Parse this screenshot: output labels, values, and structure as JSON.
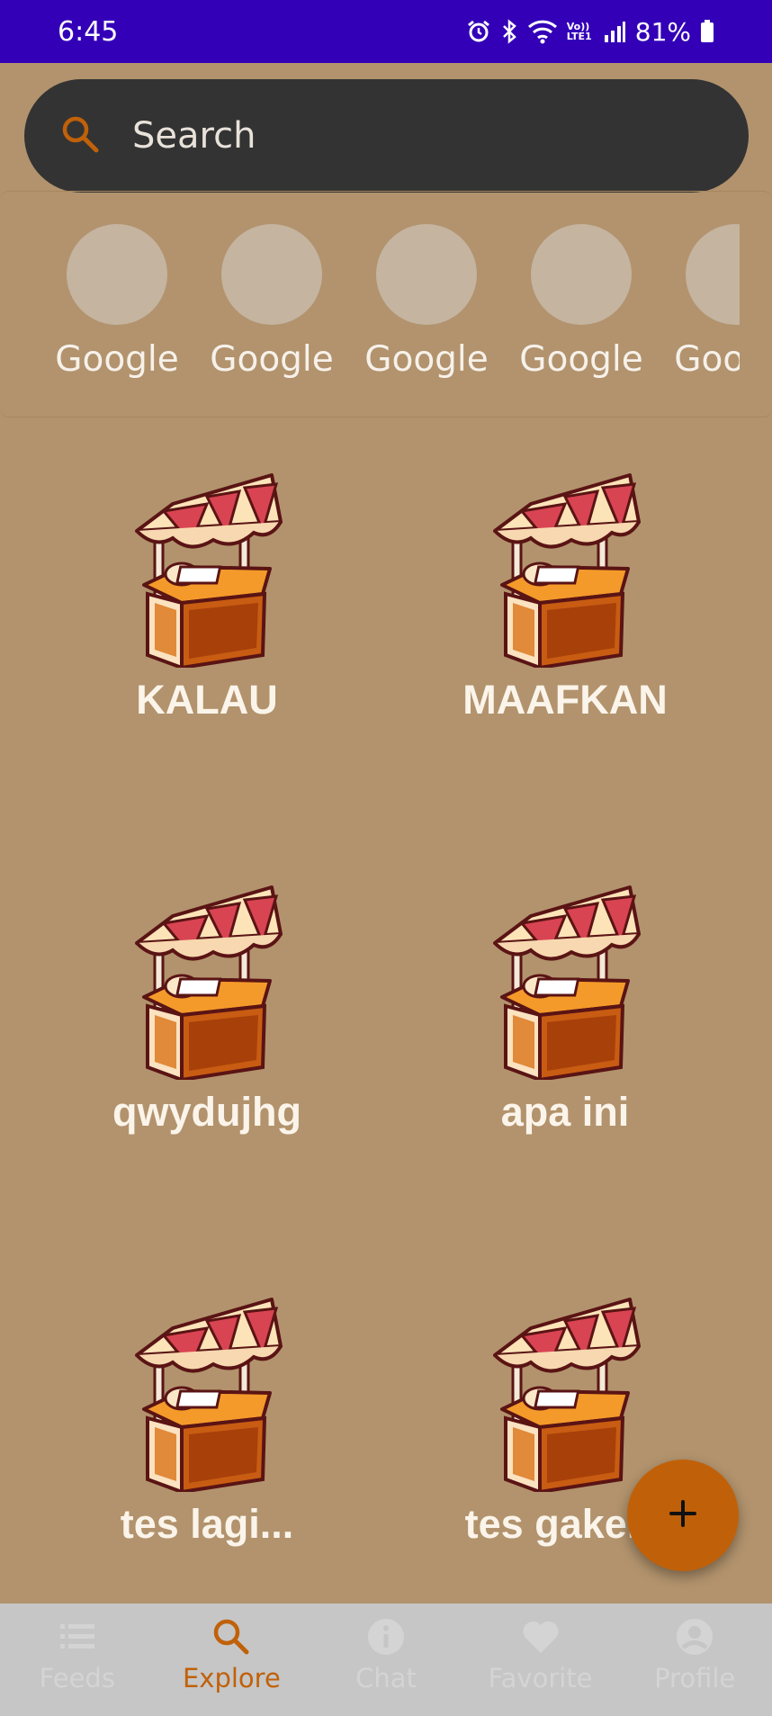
{
  "status_bar": {
    "time": "6:45",
    "network_label": "Vo)) LTE1",
    "battery": "81%"
  },
  "search": {
    "placeholder": "Search",
    "icon": "search-icon"
  },
  "categories": [
    {
      "label": "Google"
    },
    {
      "label": "Google"
    },
    {
      "label": "Google"
    },
    {
      "label": "Google"
    },
    {
      "label": "Google"
    }
  ],
  "stores": [
    {
      "name": "KALAU",
      "icon": "market-stall-icon"
    },
    {
      "name": "MAAFKAN",
      "icon": "market-stall-icon"
    },
    {
      "name": "qwydujhg",
      "icon": "market-stall-icon"
    },
    {
      "name": "apa ini",
      "icon": "market-stall-icon"
    },
    {
      "name": "tes lagi...",
      "icon": "market-stall-icon"
    },
    {
      "name": "tes gakery",
      "icon": "market-stall-icon"
    }
  ],
  "fab": {
    "icon": "plus-icon"
  },
  "bottom_nav": [
    {
      "label": "Feeds",
      "icon": "list-icon",
      "active": false
    },
    {
      "label": "Explore",
      "icon": "search-icon",
      "active": true
    },
    {
      "label": "Chat",
      "icon": "info-icon",
      "active": false
    },
    {
      "label": "Favorite",
      "icon": "heart-icon",
      "active": false
    },
    {
      "label": "Profile",
      "icon": "account-icon",
      "active": false
    }
  ],
  "colors": {
    "background": "#b2936d",
    "status_bar": "#3300b8",
    "accent": "#c0610a",
    "search_bg": "#333333",
    "nav_bg": "#c6c6c6"
  }
}
